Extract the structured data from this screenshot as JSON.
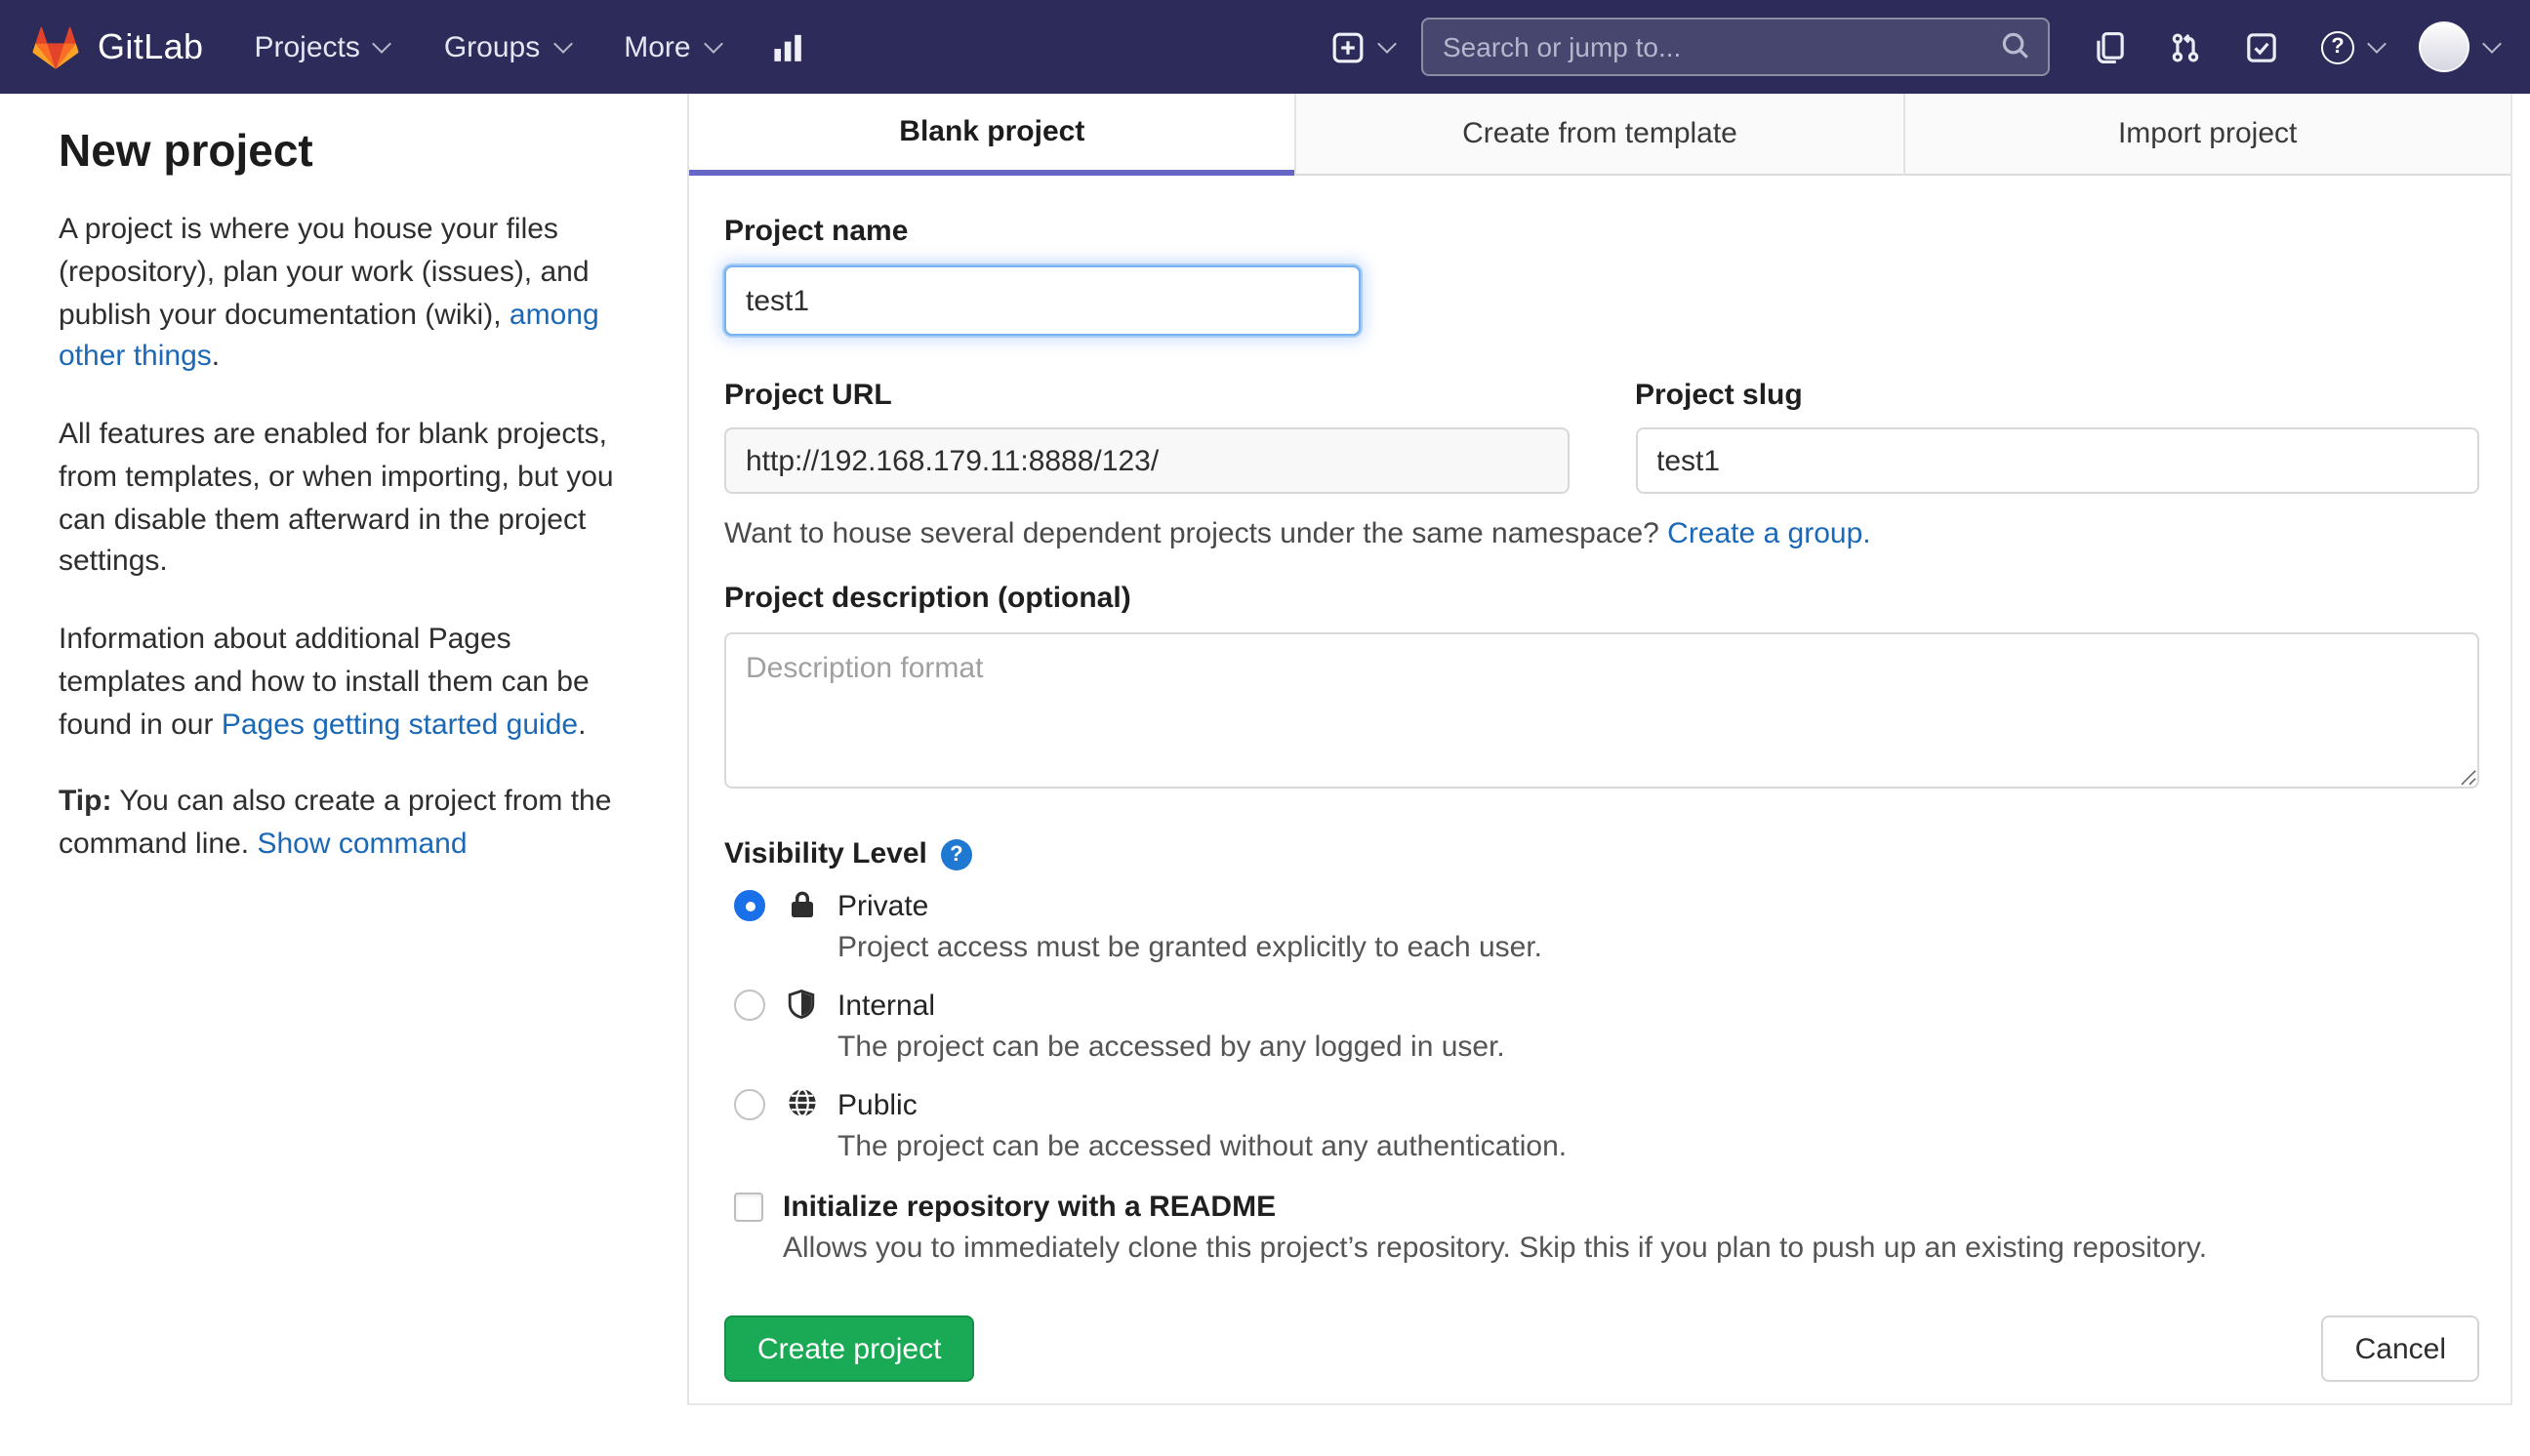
{
  "navbar": {
    "brand": "GitLab",
    "menu": [
      {
        "label": "Projects"
      },
      {
        "label": "Groups"
      },
      {
        "label": "More"
      }
    ],
    "search": {
      "placeholder": "Search or jump to..."
    }
  },
  "sidebar": {
    "title": "New project",
    "p1": {
      "text": "A project is where you house your files (repository), plan your work (issues), and publish your documentation (wiki), ",
      "link": "among other things",
      "suffix": "."
    },
    "p2": "All features are enabled for blank projects, from templates, or when importing, but you can disable them afterward in the project settings.",
    "p3": {
      "text": "Information about additional Pages templates and how to install them can be found in our ",
      "link": "Pages getting started guide",
      "suffix": "."
    },
    "tip": {
      "label": "Tip:",
      "text": " You can also create a project from the command line. ",
      "link": "Show command"
    }
  },
  "tabs": [
    {
      "label": "Blank project",
      "active": true
    },
    {
      "label": "Create from template",
      "active": false
    },
    {
      "label": "Import project",
      "active": false
    }
  ],
  "form": {
    "name": {
      "label": "Project name",
      "value": "test1"
    },
    "url": {
      "label": "Project URL",
      "value": "http://192.168.179.11:8888/123/"
    },
    "slug": {
      "label": "Project slug",
      "value": "test1"
    },
    "namespace_hint": {
      "text": "Want to house several dependent projects under the same namespace? ",
      "link": "Create a group."
    },
    "description": {
      "label": "Project description (optional)",
      "placeholder": "Description format"
    },
    "visibility": {
      "label": "Visibility Level",
      "options": [
        {
          "title": "Private",
          "description": "Project access must be granted explicitly to each user.",
          "selected": true
        },
        {
          "title": "Internal",
          "description": "The project can be accessed by any logged in user.",
          "selected": false
        },
        {
          "title": "Public",
          "description": "The project can be accessed without any authentication.",
          "selected": false
        }
      ]
    },
    "readme": {
      "label": "Initialize repository with a README",
      "description": "Allows you to immediately clone this project’s repository. Skip this if you plan to push up an existing repository."
    },
    "buttons": {
      "submit": "Create project",
      "cancel": "Cancel"
    }
  },
  "colors": {
    "navbar_bg": "#2c2b5a",
    "active_tab_underline": "#6666c4",
    "link_blue": "#1b69b6",
    "button_green": "#1aaa55",
    "radio_selected_blue": "#1a70e8",
    "help_icon_blue": "#1f78d1",
    "logo_red": "#e24329",
    "logo_orange": "#fc6d26",
    "logo_yellow": "#fca326"
  }
}
